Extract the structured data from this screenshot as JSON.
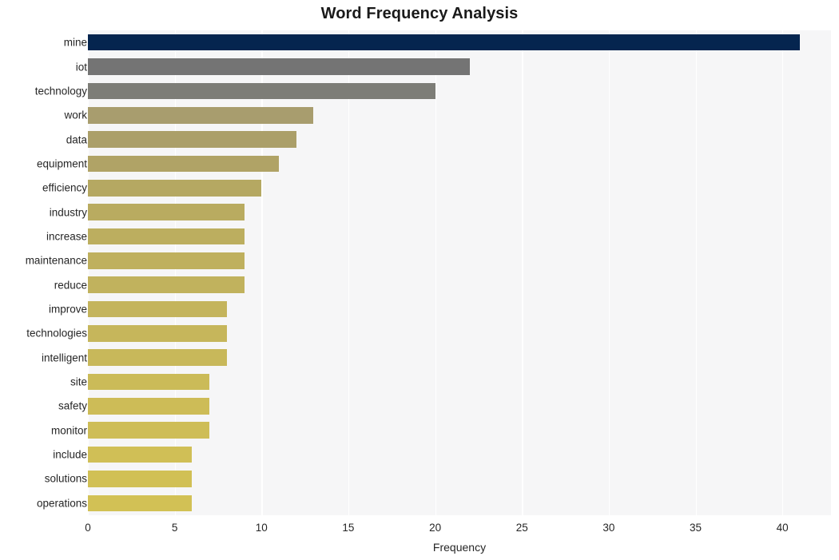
{
  "chart_data": {
    "type": "bar",
    "orientation": "horizontal",
    "title": "Word Frequency Analysis",
    "xlabel": "Frequency",
    "ylabel": "",
    "categories": [
      "mine",
      "iot",
      "technology",
      "work",
      "data",
      "equipment",
      "efficiency",
      "industry",
      "increase",
      "maintenance",
      "reduce",
      "improve",
      "technologies",
      "intelligent",
      "site",
      "safety",
      "monitor",
      "include",
      "solutions",
      "operations"
    ],
    "values": [
      41,
      22,
      20,
      13,
      12,
      11,
      10,
      9,
      9,
      9,
      9,
      8,
      8,
      8,
      7,
      7,
      7,
      6,
      6,
      6
    ],
    "bar_colors": [
      "#05254f",
      "#747474",
      "#7d7d77",
      "#a89d6e",
      "#ab9f69",
      "#b0a366",
      "#b5a862",
      "#b9ab60",
      "#bcae5f",
      "#bfb05e",
      "#c1b25d",
      "#c4b45c",
      "#c6b65b",
      "#c8b85a",
      "#cbbb58",
      "#cdbc57",
      "#cebd57",
      "#d0bf56",
      "#d1c055",
      "#d2c155"
    ],
    "xlim": [
      0,
      42.8
    ],
    "xticks": [
      0,
      5,
      10,
      15,
      20,
      25,
      30,
      35,
      40
    ],
    "xtick_labels": [
      "0",
      "5",
      "10",
      "15",
      "20",
      "25",
      "30",
      "35",
      "40"
    ],
    "grid": "vertical",
    "grid_color": "#ffffff",
    "plot_background": "#f6f6f7",
    "figure_background": "#ffffff",
    "legend": null
  }
}
